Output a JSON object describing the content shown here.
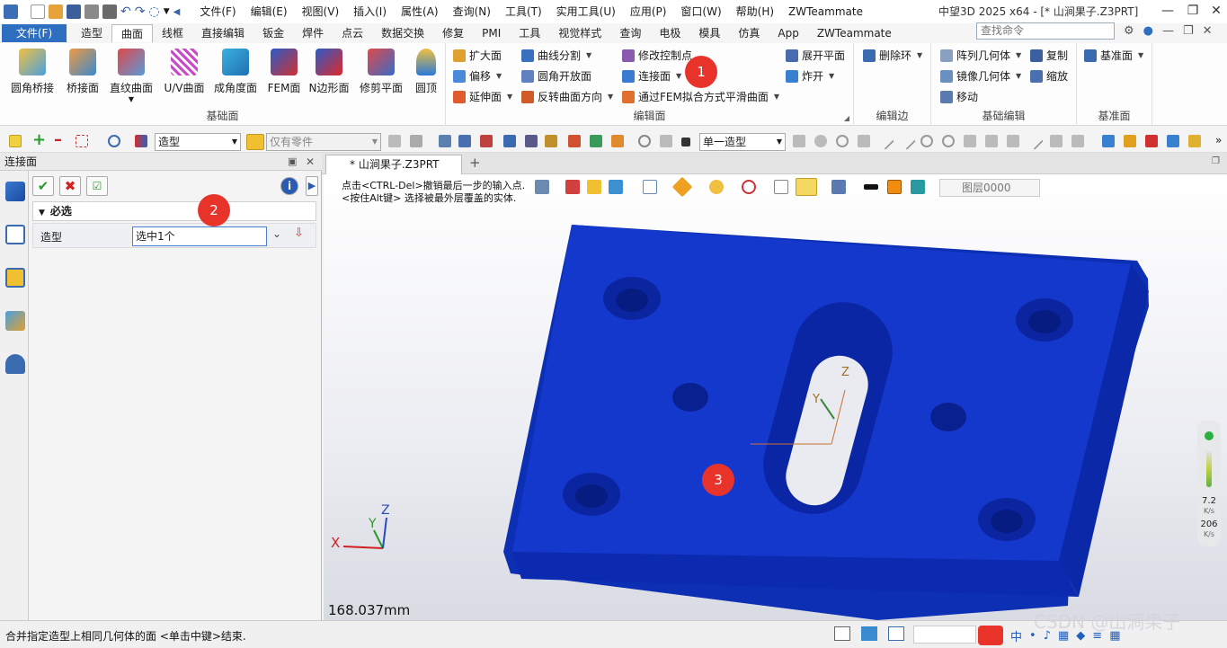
{
  "titlebar": {
    "menus": [
      "文件(F)",
      "编辑(E)",
      "视图(V)",
      "插入(I)",
      "属性(A)",
      "查询(N)",
      "工具(T)",
      "实用工具(U)",
      "应用(P)",
      "窗口(W)",
      "帮助(H)",
      "ZWTeammate"
    ],
    "title": "中望3D 2025 x64 - [* 山涧果子.Z3PRT]"
  },
  "tabs": [
    "文件(F)",
    "造型",
    "曲面",
    "线框",
    "直接编辑",
    "钣金",
    "焊件",
    "点云",
    "数据交换",
    "修复",
    "PMI",
    "工具",
    "视觉样式",
    "查询",
    "电极",
    "模具",
    "仿真",
    "App",
    "ZWTeammate"
  ],
  "command_search": {
    "placeholder": "查找命令"
  },
  "ribbon": {
    "basic_surface": {
      "label": "基础面",
      "buttons": [
        "圆角桥接",
        "桥接面",
        "直纹曲面",
        "U/V曲面",
        "成角度面",
        "FEM面",
        "N边形面",
        "修剪平面",
        "圆顶"
      ]
    },
    "edit_surface": {
      "label": "编辑面",
      "col1": [
        "扩大面",
        "偏移",
        "延伸面"
      ],
      "col2": [
        "曲线分割",
        "圆角开放面",
        "反转曲面方向"
      ],
      "col3": [
        "修改控制点",
        "连接面",
        "通过FEM拟合方式平滑曲面"
      ],
      "col4": [
        "展开平面",
        "炸开"
      ]
    },
    "edit_edge": {
      "label": "编辑边",
      "buttons": [
        "删除环"
      ]
    },
    "basic_edit": {
      "label": "基础编辑",
      "col1": [
        "阵列几何体",
        "镜像几何体",
        "移动"
      ],
      "col2": [
        "复制",
        "缩放"
      ]
    },
    "datum": {
      "label": "基准面",
      "buttons": [
        "基准面"
      ]
    }
  },
  "toolbar": {
    "filter": "造型",
    "scope": "仅有零件",
    "shape_mode": "单一造型"
  },
  "panel": {
    "title": "连接面",
    "section": "必选",
    "field_label": "造型",
    "field_value": "选中1个"
  },
  "document": {
    "tab": "* 山涧果子.Z3PRT",
    "hint1": "点击<CTRL-Del>撤销最后一步的输入点.",
    "hint2": "<按住Alt键> 选择被最外层覆盖的实体.",
    "layer": "图层0000",
    "distance": "168.037mm"
  },
  "fps": {
    "fps_value": "7.2",
    "fps_unit": "K/s",
    "tri_value": "206",
    "tri_unit": "K/s"
  },
  "triad": {
    "x": "X",
    "y": "Y",
    "z": "Z"
  },
  "badges": [
    "1",
    "2",
    "3"
  ],
  "status": {
    "text": "合并指定造型上相同几何体的面 <单击中键>结束.",
    "ime": "中"
  },
  "watermark": "CSDN @山涧果子",
  "colors": {
    "accent": "#2f6fc2",
    "model": "#1236c9",
    "badge": "#e8332b"
  }
}
